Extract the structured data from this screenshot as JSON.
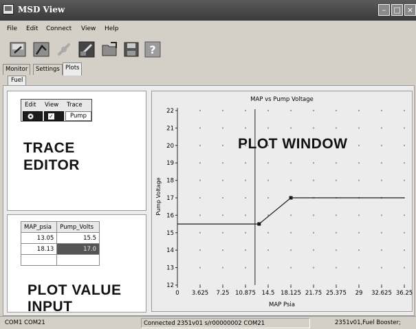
{
  "window": {
    "title": "MSD View",
    "controls": [
      "minimize",
      "maximize",
      "close"
    ]
  },
  "menu": [
    "File",
    "Edit",
    "Connect",
    "View",
    "Help"
  ],
  "toolbar": {
    "buttons": [
      "save-plot-icon",
      "open-plot-icon",
      "connect-link-icon",
      "program-icon",
      "open-folder-icon",
      "floppy-save-icon",
      "help-icon"
    ],
    "help_glyph": "?"
  },
  "tabs": [
    "Monitor",
    "Settings",
    "Plots"
  ],
  "active_tab": "Plots",
  "subtab": "Fuel",
  "trace_editor": {
    "headers": [
      "Edit",
      "View",
      "Trace"
    ],
    "trace_name": "Pump",
    "check_glyph": "✓",
    "annotation_line1": "TRACE",
    "annotation_line2": "EDITOR"
  },
  "plot_value_input": {
    "columns": [
      "MAP_psia",
      "Pump_Volts"
    ],
    "rows": [
      {
        "map": "13.05",
        "volts": "15.5"
      },
      {
        "map": "18.13",
        "volts": "17.0"
      },
      {
        "map": "",
        "volts": ""
      }
    ],
    "annotation_line1": "PLOT VALUE",
    "annotation_line2": "INPUT"
  },
  "plot_window_annotation": "PLOT WINDOW",
  "chart_data": {
    "type": "line",
    "title": "MAP vs Pump Voltage",
    "xlabel": "MAP Psia",
    "ylabel": "Pump Voltage",
    "x_ticks": [
      "0",
      "3.625",
      "7.25",
      "10.875",
      "14.5",
      "18.125",
      "21.75",
      "25.375",
      "29",
      "32.625",
      "36.25"
    ],
    "y_ticks": [
      "12",
      "13",
      "14",
      "15",
      "16",
      "17",
      "18",
      "19",
      "20",
      "21",
      "22"
    ],
    "xlim": [
      0,
      36.25
    ],
    "ylim": [
      12,
      22
    ],
    "grid": "dots",
    "series": [
      {
        "x": [
          0,
          13.05,
          18.13,
          36.25
        ],
        "y": [
          15.5,
          15.5,
          17.0,
          17.0
        ],
        "markers": [
          {
            "x": 13.05,
            "y": 15.5
          },
          {
            "x": 18.13,
            "y": 17.0
          }
        ]
      }
    ],
    "cursor_x": 12.4,
    "colors": {
      "line": "#1a1a1a",
      "grid": "#9a9a9a"
    }
  },
  "status": {
    "left": "COM1  COM21",
    "middle": "Connected 2351v01 s/r00000002 COM21",
    "right": "2351v01,Fuel Booster;"
  }
}
